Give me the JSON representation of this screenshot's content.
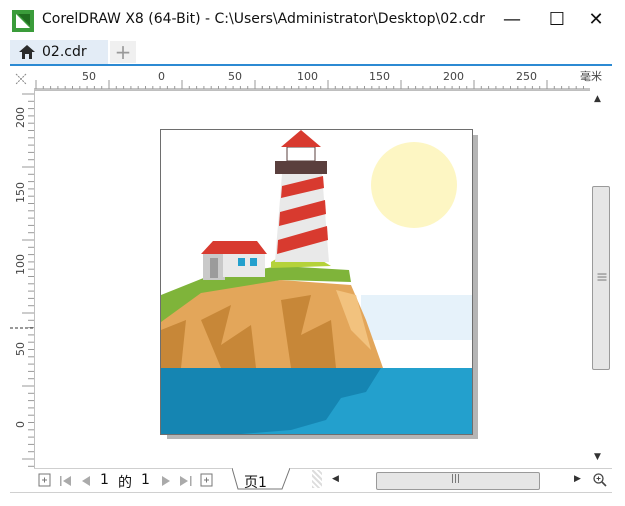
{
  "window": {
    "title": "CorelDRAW X8 (64-Bit) - C:\\Users\\Administrator\\Desktop\\02.cdr",
    "minimize_glyph": "—",
    "maximize_glyph": "☐",
    "close_glyph": "✕"
  },
  "tabs": [
    {
      "label": "02.cdr",
      "icon": "home-icon",
      "active": true
    }
  ],
  "add_tab_glyph": "+",
  "rulers": {
    "unit_label": "毫米",
    "horizontal_ticks": [
      "50",
      "0",
      "50",
      "100",
      "150",
      "200",
      "250"
    ],
    "vertical_ticks": [
      "200",
      "150",
      "100",
      "50",
      "0"
    ]
  },
  "page_nav": {
    "current": "1",
    "of_text": "的",
    "total": "1",
    "page_tab_label": "页1"
  },
  "scroll_glyphs": {
    "up": "▲",
    "down": "▼",
    "left": "◀",
    "right": "▶",
    "thumb_grip": "|||"
  },
  "colors": {
    "accent": "#2c8ad3",
    "sky_sun": "#fdf6c3",
    "sea": "#23a0cd",
    "cliff": "#e3a65a",
    "grass": "#7fb43a",
    "lighthouse_red": "#d83a2f"
  }
}
